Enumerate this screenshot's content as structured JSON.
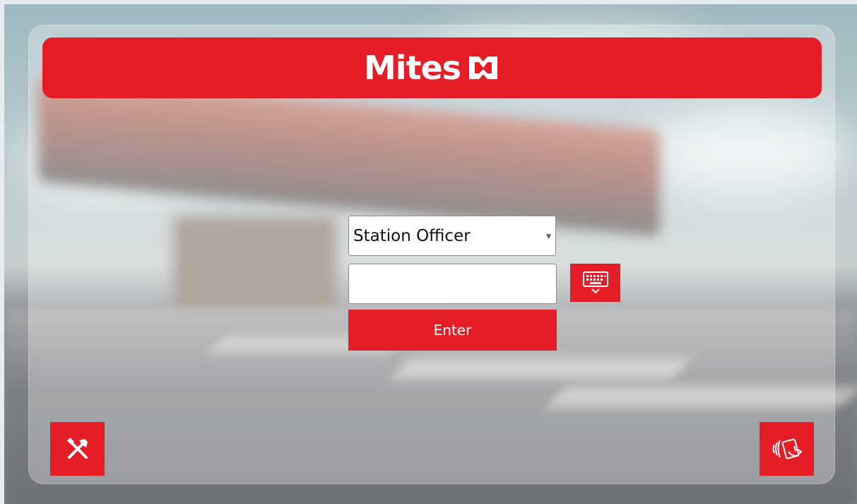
{
  "brand": {
    "name": "Mites",
    "color": "#e41d26"
  },
  "login": {
    "role_selected": "Station Officer",
    "pin_value": "",
    "enter_label": "Enter"
  },
  "icons": {
    "keyboard": "keyboard-icon",
    "tools": "tools-icon",
    "card": "contactless-card-icon"
  }
}
